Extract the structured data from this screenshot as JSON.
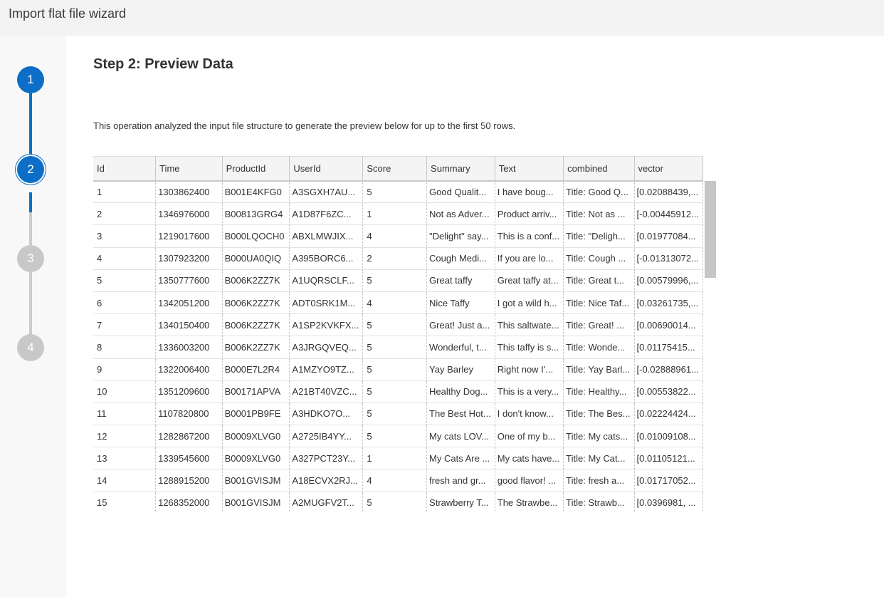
{
  "window": {
    "title": "Import flat file wizard"
  },
  "stepper": {
    "steps": [
      "1",
      "2",
      "3",
      "4"
    ],
    "current_step": 2
  },
  "main": {
    "heading": "Step 2: Preview Data",
    "description": "This operation analyzed the input file structure to generate the preview below for up to the first 50 rows."
  },
  "grid": {
    "columns": [
      "Id",
      "Time",
      "ProductId",
      "UserId",
      "Score",
      "Summary",
      "Text",
      "combined",
      "vector"
    ],
    "rows": [
      [
        "1",
        "1303862400",
        "B001E4KFG0",
        "A3SGXH7AU...",
        "5",
        "Good Qualit...",
        "I have boug...",
        "Title: Good Q...",
        "[0.02088439,..."
      ],
      [
        "2",
        "1346976000",
        "B00813GRG4",
        "A1D87F6ZC...",
        "1",
        "Not as Adver...",
        "Product arriv...",
        "Title: Not as ...",
        "[-0.00445912..."
      ],
      [
        "3",
        "1219017600",
        "B000LQOCH0",
        "ABXLMWJIX...",
        "4",
        "\"Delight\" say...",
        "This is a conf...",
        "Title: \"Deligh...",
        "[0.01977084..."
      ],
      [
        "4",
        "1307923200",
        "B000UA0QIQ",
        "A395BORC6...",
        "2",
        "Cough Medi...",
        "If you are lo...",
        "Title: Cough ...",
        "[-0.01313072..."
      ],
      [
        "5",
        "1350777600",
        "B006K2ZZ7K",
        "A1UQRSCLF...",
        "5",
        "Great taffy",
        "Great taffy at...",
        "Title: Great t...",
        "[0.00579996,..."
      ],
      [
        "6",
        "1342051200",
        "B006K2ZZ7K",
        "ADT0SRK1M...",
        "4",
        "Nice Taffy",
        "I got a wild h...",
        "Title: Nice Taf...",
        "[0.03261735,..."
      ],
      [
        "7",
        "1340150400",
        "B006K2ZZ7K",
        "A1SP2KVKFX...",
        "5",
        "Great!  Just a...",
        "This saltwate...",
        "Title: Great!  ...",
        "[0.00690014..."
      ],
      [
        "8",
        "1336003200",
        "B006K2ZZ7K",
        "A3JRGQVEQ...",
        "5",
        "Wonderful, t...",
        "This taffy is s...",
        "Title: Wonde...",
        "[0.01175415..."
      ],
      [
        "9",
        "1322006400",
        "B000E7L2R4",
        "A1MZYO9TZ...",
        "5",
        "Yay Barley",
        "Right now I'...",
        "Title: Yay Barl...",
        "[-0.02888961..."
      ],
      [
        "10",
        "1351209600",
        "B00171APVA",
        "A21BT40VZC...",
        "5",
        "Healthy Dog...",
        "This is a very...",
        "Title: Healthy...",
        "[0.00553822..."
      ],
      [
        "11",
        "1107820800",
        "B0001PB9FE",
        "A3HDKO7O...",
        "5",
        "The Best Hot...",
        "I don't know...",
        "Title: The Bes...",
        "[0.02224424..."
      ],
      [
        "12",
        "1282867200",
        "B0009XLVG0",
        "A2725IB4YY...",
        "5",
        "My cats LOV...",
        "One of my b...",
        "Title: My cats...",
        "[0.01009108..."
      ],
      [
        "13",
        "1339545600",
        "B0009XLVG0",
        "A327PCT23Y...",
        "1",
        "My Cats Are ...",
        "My cats have...",
        "Title: My Cat...",
        "[0.01105121..."
      ],
      [
        "14",
        "1288915200",
        "B001GVISJM",
        "A18ECVX2RJ...",
        "4",
        "fresh and gr...",
        "good flavor! ...",
        "Title: fresh a...",
        "[0.01717052..."
      ],
      [
        "15",
        "1268352000",
        "B001GVISJM",
        "A2MUGFV2T...",
        "5",
        "Strawberry T...",
        "The Strawbe...",
        "Title: Strawb...",
        "[0.0396981, ..."
      ]
    ]
  },
  "colors": {
    "accent": "#0c6ec7",
    "pending": "#c8c8c8"
  }
}
